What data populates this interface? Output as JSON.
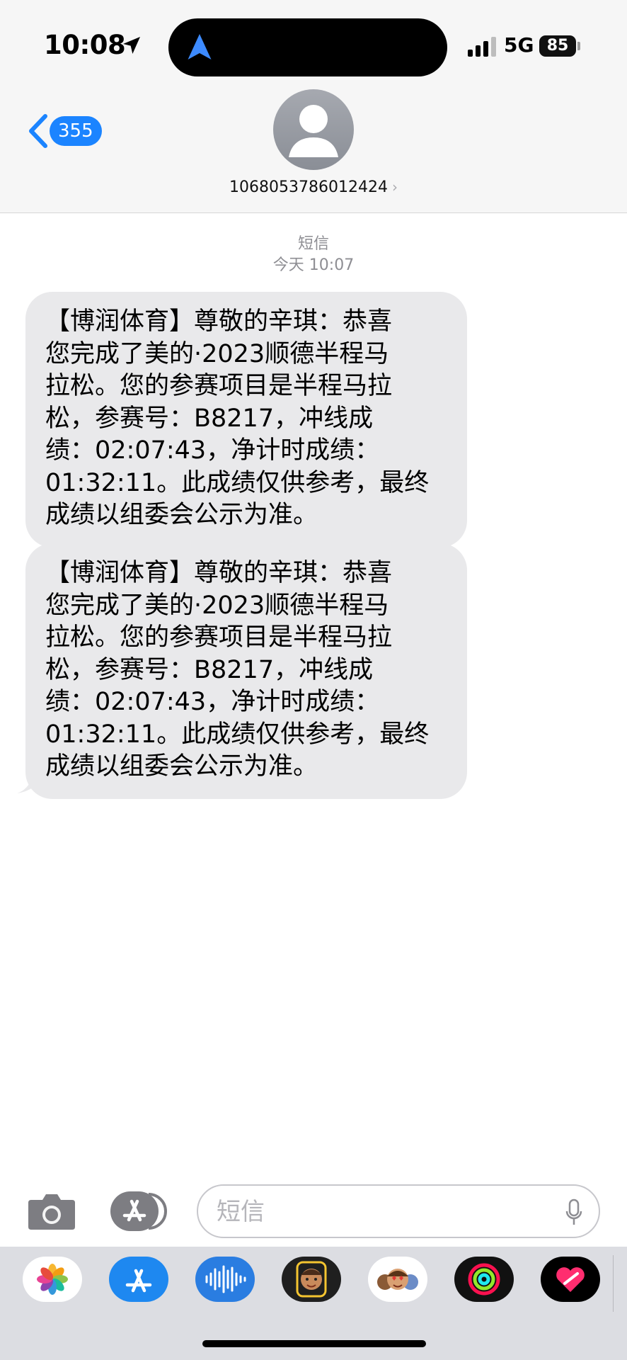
{
  "status_bar": {
    "time": "10:08",
    "network": "5G",
    "battery": "85"
  },
  "nav": {
    "back_count": "355",
    "contact": "1068053786012424",
    "contact_chevron": "›"
  },
  "thread": {
    "label": "短信",
    "timestamp": "今天 10:07"
  },
  "messages": [
    {
      "lines": [
        "【博润体育】尊敬的辛琪：恭喜",
        "您完成了美的·2023顺德半程马",
        "拉松。您的参赛项目是半程马拉",
        "松，参赛号：B8217，冲线成",
        "绩：02:07:43，净计时成绩：",
        "01:32:11。此成绩仅供参考，最终",
        "成绩以组委会公示为准。"
      ]
    },
    {
      "lines": [
        "【博润体育】尊敬的辛琪：恭喜",
        "您完成了美的·2023顺德半程马",
        "拉松。您的参赛项目是半程马拉",
        "松，参赛号：B8217，冲线成",
        "绩：02:07:43，净计时成绩：",
        "01:32:11。此成绩仅供参考，最终",
        "成绩以组委会公示为准。"
      ]
    }
  ],
  "composer": {
    "placeholder": "短信"
  },
  "colors": {
    "accent": "#1b84ff",
    "bubble": "#e9e9eb",
    "header_bg": "#f6f6f6",
    "tray_bg": "#dcdde2"
  },
  "app_tray": [
    "photos-icon",
    "app-store-icon",
    "audio-message-icon",
    "memoji-icon",
    "memoji-stickers-icon",
    "activity-icon",
    "digital-touch-icon"
  ]
}
